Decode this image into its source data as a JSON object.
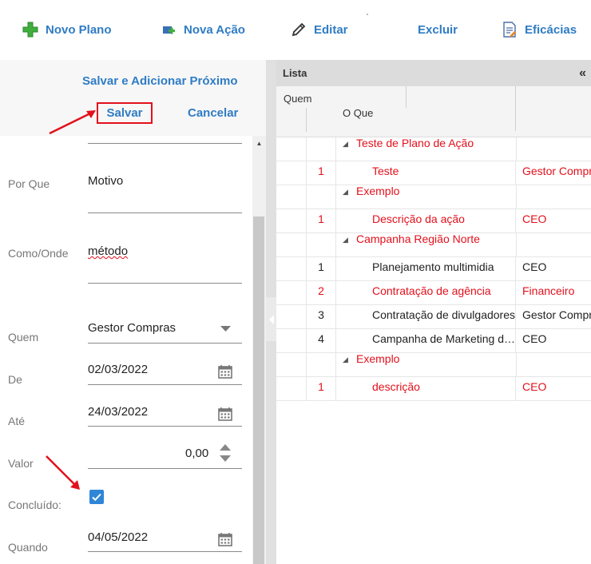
{
  "toolbar": {
    "novo_plano": "Novo Plano",
    "nova_acao": "Nova Ação",
    "editar": "Editar",
    "excluir": "Excluir",
    "eficacias": "Eficácias"
  },
  "form_actions": {
    "salvar_adicionar": "Salvar e Adicionar Próximo",
    "salvar": "Salvar",
    "cancelar": "Cancelar"
  },
  "form": {
    "por_que_label": "Por Que",
    "por_que_value": "Motivo",
    "como_onde_label": "Como/Onde",
    "como_onde_value": "método",
    "quem_label": "Quem",
    "quem_value": "Gestor Compras",
    "de_label": "De",
    "de_value": "02/03/2022",
    "ate_label": "Até",
    "ate_value": "24/03/2022",
    "valor_label": "Valor",
    "valor_value": "0,00",
    "concluido_label": "Concluído:",
    "concluido_checked": true,
    "quando_label": "Quando",
    "quando_value": "04/05/2022"
  },
  "grid": {
    "title": "Lista",
    "col_quem": "Quem",
    "col_oque": "O Que",
    "rows": [
      {
        "type": "group",
        "text": "Teste de Plano de Ação"
      },
      {
        "type": "item",
        "num": "1",
        "what": "Teste",
        "who": "Gestor Compras",
        "color": "red"
      },
      {
        "type": "group",
        "text": "Exemplo"
      },
      {
        "type": "item",
        "num": "1",
        "what": "Descrição da ação",
        "who": "CEO",
        "color": "red"
      },
      {
        "type": "group",
        "text": "Campanha Região Norte"
      },
      {
        "type": "item",
        "num": "1",
        "what": "Planejamento multimidia",
        "who": "CEO",
        "color": "black"
      },
      {
        "type": "item",
        "num": "2",
        "what": "Contratação de agência",
        "who": "Financeiro",
        "color": "red"
      },
      {
        "type": "item",
        "num": "3",
        "what": "Contratação de divulgadores",
        "who": "Gestor Compras",
        "color": "black"
      },
      {
        "type": "item",
        "num": "4",
        "what": "Campanha de Marketing digital",
        "who": "CEO",
        "color": "black"
      },
      {
        "type": "group",
        "text": "Exemplo"
      },
      {
        "type": "item",
        "num": "1",
        "what": "descrição",
        "who": "CEO",
        "color": "red"
      }
    ]
  },
  "colors": {
    "link_blue": "#2f7cc4",
    "highlight_red": "#e3101c",
    "checkbox_blue": "#2f86d8"
  }
}
